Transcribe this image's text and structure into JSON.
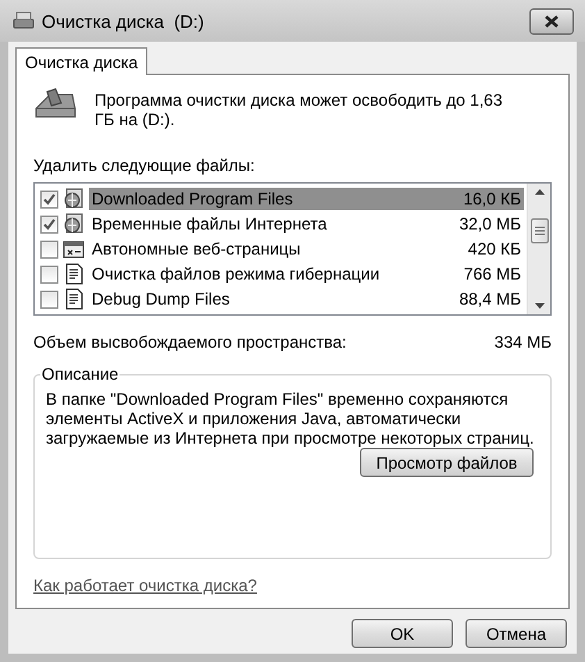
{
  "window": {
    "title": "Очистка диска  (D:)"
  },
  "tabs": [
    {
      "label": "Очистка диска",
      "selected": true
    }
  ],
  "intro": "Программа очистки диска может освободить до 1,63 ГБ на (D:).",
  "files_label": "Удалить следующие файлы:",
  "files": [
    {
      "kind": "web",
      "name": "Downloaded Program Files",
      "size": "16,0 КБ",
      "checked": true,
      "selected": true
    },
    {
      "kind": "web",
      "name": "Временные файлы Интернета",
      "size": "32,0 МБ",
      "checked": true,
      "selected": false
    },
    {
      "kind": "offline",
      "name": "Автономные веб-страницы",
      "size": "420 КБ",
      "checked": false,
      "selected": false
    },
    {
      "kind": "doc",
      "name": "Очистка файлов режима гибернации",
      "size": "766 МБ",
      "checked": false,
      "selected": false
    },
    {
      "kind": "doc",
      "name": "Debug Dump Files",
      "size": "88,4 МБ",
      "checked": false,
      "selected": false
    }
  ],
  "total": {
    "label": "Объем высвобождаемого пространства:",
    "value": "334 МБ"
  },
  "description": {
    "title": "Описание",
    "text": "В папке \"Downloaded Program Files\" временно сохраняются элементы ActiveX и приложения Java, автоматически загружаемые из Интернета при просмотре некоторых страниц."
  },
  "view_button": "Просмотр файлов",
  "help_link": "Как работает очистка диска?",
  "buttons": [
    "OK",
    "Отмена"
  ]
}
